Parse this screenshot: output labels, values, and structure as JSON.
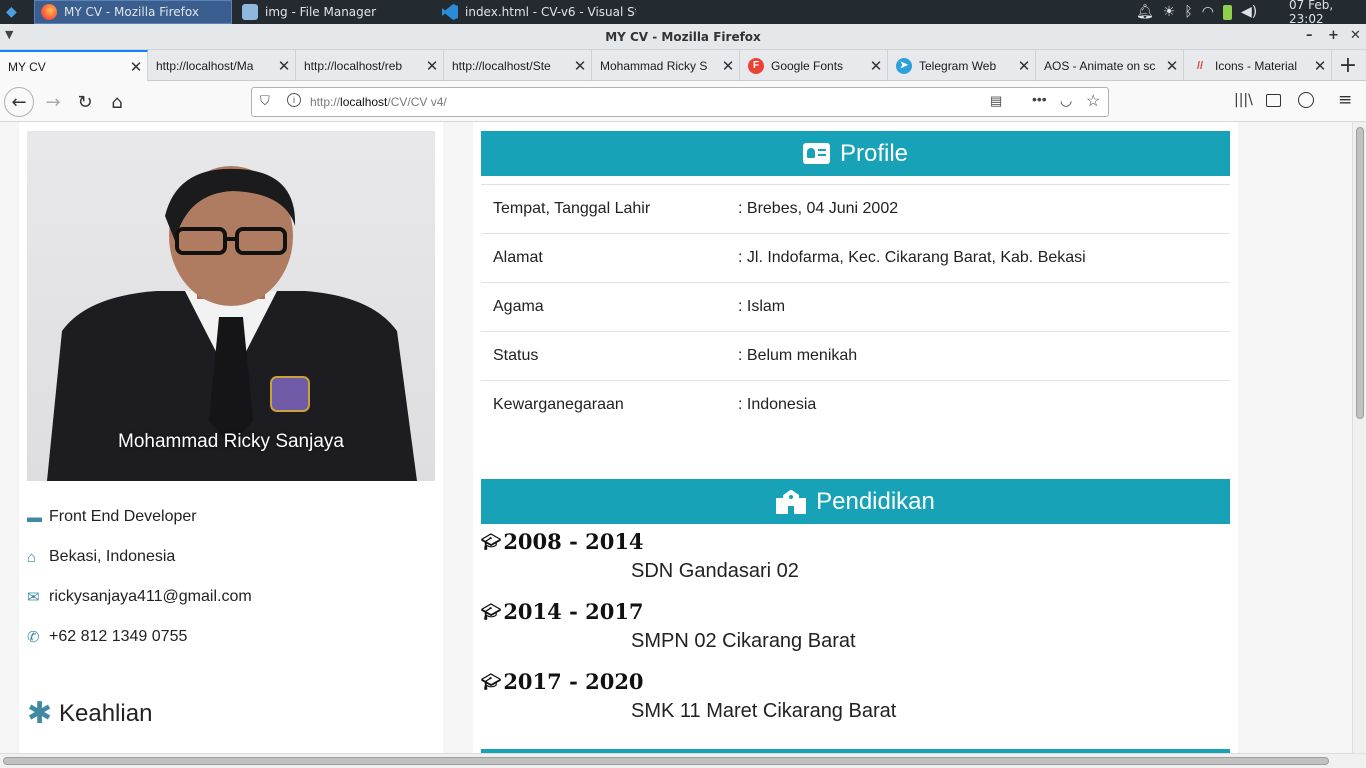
{
  "panel": {
    "tasks": [
      {
        "label": "MY CV - Mozilla Firefox",
        "icon": "firefox-icon",
        "active": true
      },
      {
        "label": "img - File Manager",
        "icon": "folder-icon",
        "active": false
      },
      {
        "label": "index.html - CV-v6 - Visual St...",
        "icon": "vscode-icon",
        "active": false
      }
    ],
    "clock": "07 Feb, 23:02"
  },
  "window": {
    "title": "MY CV - Mozilla Firefox"
  },
  "tabs": [
    {
      "label": "MY CV",
      "selected": true
    },
    {
      "label": "http://localhost/Ma",
      "selected": false
    },
    {
      "label": "http://localhost/reb",
      "selected": false
    },
    {
      "label": "http://localhost/Ste",
      "selected": false
    },
    {
      "label": "Mohammad Ricky S",
      "selected": false
    },
    {
      "label": "Google Fonts",
      "selected": false,
      "fav": "F",
      "favcolor": "#ea4335"
    },
    {
      "label": "Telegram Web",
      "selected": false,
      "fav": "➤",
      "favcolor": "#2aa1da"
    },
    {
      "label": "AOS - Animate on sc",
      "selected": false
    },
    {
      "label": "Icons - Material",
      "selected": false,
      "fav": "//",
      "favcolor": "#ffffff"
    }
  ],
  "url": {
    "prefix": "http://",
    "host": "localhost",
    "path": "/CV/CV v4/"
  },
  "cv": {
    "name": "Mohammad Ricky Sanjaya",
    "role": "Front End Developer",
    "location": "Bekasi, Indonesia",
    "email": "rickysanjaya411@gmail.com",
    "phone": "+62 812 1349 0755",
    "skills_title": "Keahlian",
    "profile_title": "Profile",
    "profile": [
      {
        "key": "Tempat, Tanggal Lahir",
        "value": ": Brebes, 04 Juni 2002"
      },
      {
        "key": "Alamat",
        "value": ": Jl. Indofarma, Kec. Cikarang Barat, Kab. Bekasi"
      },
      {
        "key": "Agama",
        "value": ": Islam"
      },
      {
        "key": "Status",
        "value": ": Belum menikah"
      },
      {
        "key": "Kewarganegaraan",
        "value": ": Indonesia"
      }
    ],
    "education_title": "Pendidikan",
    "education": [
      {
        "years": "2008 - 2014",
        "school": "SDN Gandasari 02"
      },
      {
        "years": "2014 - 2017",
        "school": "SMPN 02 Cikarang Barat"
      },
      {
        "years": "2017 - 2020",
        "school": "SMK 11 Maret Cikarang Barat"
      }
    ]
  },
  "colors": {
    "accent": "#17a2b8",
    "icon": "#3f8aa2"
  }
}
